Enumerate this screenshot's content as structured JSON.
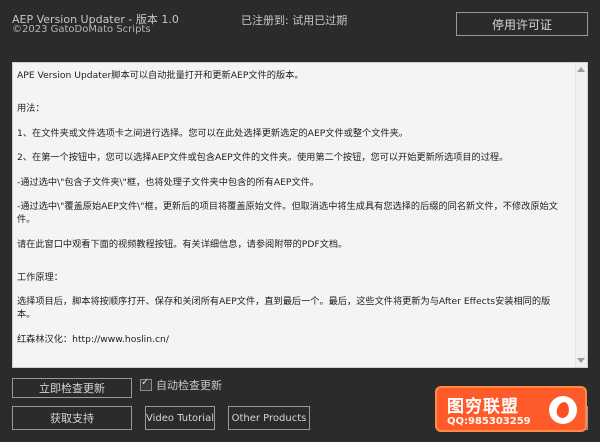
{
  "header": {
    "title": "AEP Version Updater - 版本 1.0",
    "copyright": "©2023 GatoDoMato Scripts",
    "status": "已注册到:  试用已过期",
    "disable_license_button": "停用许可证"
  },
  "panel": {
    "paragraphs": [
      "APE Version Updater脚本可以自动批量打开和更新AEP文件的版本。",
      "用法：",
      "1、在文件夹或文件选项卡之间进行选择。您可以在此处选择更新选定的AEP文件或整个文件夹。",
      "2、在第一个按钮中，您可以选择AEP文件或包含AEP文件的文件夹。使用第二个按钮，您可以开始更新所选项目的过程。",
      "-通过选中\\\"包含子文件夹\\\"框，也将处理子文件夹中包含的所有AEP文件。",
      "-通过选中\\\"覆盖原始AEP文件\\\"框，更新后的项目将覆盖原始文件。但取消选中将生成具有您选择的后缀的同名新文件，不修改原始文件。",
      "请在此窗口中观看下面的视频教程按钮。有关详细信息，请参阅附带的PDF文档。",
      "工作原理：",
      "选择项目后，脚本将按顺序打开、保存和关闭所有AEP文件，直到最后一个。最后，这些文件将更新为与After Effects安装相同的版本。",
      "红森林汉化：http://www.hoslin.cn/"
    ]
  },
  "footer": {
    "check_update_button": "立即检查更新",
    "auto_check_label": "自动检查更新",
    "auto_check_checked": true,
    "support_button": "获取支持",
    "video_tutorial_button": "Video Tutorial",
    "other_products_button": "Other Products"
  },
  "watermark": {
    "main": "图穷联盟",
    "sub": "QQ:985303259",
    "logo": "flame-icon"
  }
}
